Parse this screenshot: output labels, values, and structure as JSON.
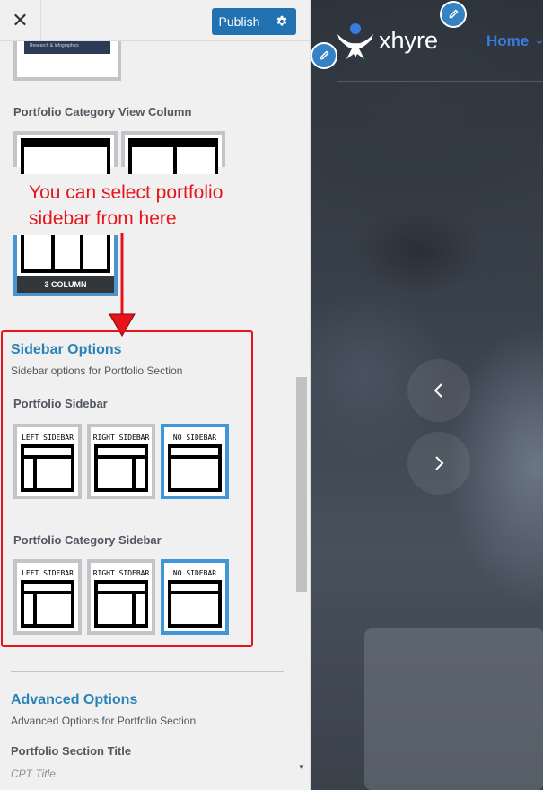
{
  "toolbar": {
    "close_glyph": "✕",
    "publish_label": "Publish",
    "settings_icon": "gear-icon"
  },
  "top_thumbnail": {
    "caption": "Research & Infographics"
  },
  "category_view": {
    "label": "Portfolio Category View Column",
    "selected_caption": "3 COLUMN"
  },
  "annotation": {
    "text": "You can select portfolio sidebar from here",
    "color": "#e8131a"
  },
  "sidebar_options": {
    "title": "Sidebar Options",
    "description": "Sidebar options for Portfolio Section",
    "portfolio_sidebar": {
      "label": "Portfolio Sidebar",
      "options": [
        "LEFT SIDEBAR",
        "RIGHT SIDEBAR",
        "NO SIDEBAR"
      ],
      "selected": "NO SIDEBAR"
    },
    "category_sidebar": {
      "label": "Portfolio Category Sidebar",
      "options": [
        "LEFT SIDEBAR",
        "RIGHT SIDEBAR",
        "NO SIDEBAR"
      ],
      "selected": "NO SIDEBAR"
    }
  },
  "advanced_options": {
    "title": "Advanced Options",
    "description": "Advanced Options for Portfolio Section",
    "section_title_label": "Portfolio Section Title",
    "section_title_value": "CPT Title"
  },
  "preview": {
    "logo_text": "xhyre",
    "nav_home": "Home",
    "accent": "#3a7be0",
    "prev_icon": "chevron-left-icon",
    "next_icon": "chevron-right-icon",
    "edit_icon": "pencil-icon"
  },
  "colors": {
    "primary": "#2271b1",
    "section_title": "#2a83b7",
    "selected_border": "#3f97d6"
  }
}
